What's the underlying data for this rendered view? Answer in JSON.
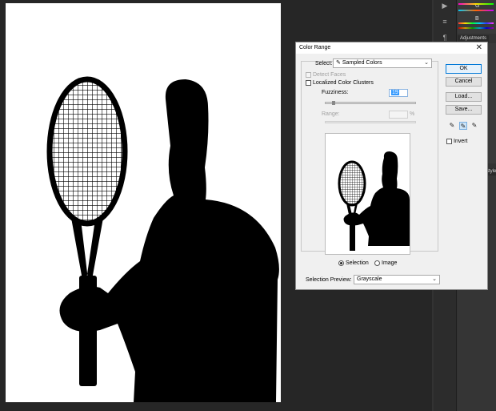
{
  "dialog": {
    "title": "Color Range",
    "close_glyph": "✕",
    "select_label": "Select:",
    "select_value": "Sampled Colors",
    "select_icon": "eyedropper-icon",
    "detect_faces_label": "Detect Faces",
    "detect_faces_checked": false,
    "localized_label": "Localized Color Clusters",
    "localized_checked": false,
    "fuzziness_label": "Fuzziness:",
    "fuzziness_value": "19",
    "range_label": "Range:",
    "range_unit": "%",
    "radio_selection_label": "Selection",
    "radio_image_label": "Image",
    "radio_selected": "Selection",
    "preview_label": "Selection Preview:",
    "preview_value": "Grayscale",
    "buttons": {
      "ok": "OK",
      "cancel": "Cancel",
      "load": "Load...",
      "save": "Save..."
    },
    "invert_label": "Invert",
    "invert_checked": false,
    "eyedroppers": [
      "eyedropper-icon",
      "eyedropper-plus-icon",
      "eyedropper-minus-icon"
    ],
    "active_eyedropper": "eyedropper-plus-icon"
  },
  "panels": {
    "tab_adjustments": "Adjustments",
    "tab_styles": "Styles",
    "label_g": "G",
    "label_b": "B"
  },
  "colors": {
    "workspace": "#262626",
    "ok_border": "#0078d7",
    "highlight": "#3399ff"
  }
}
